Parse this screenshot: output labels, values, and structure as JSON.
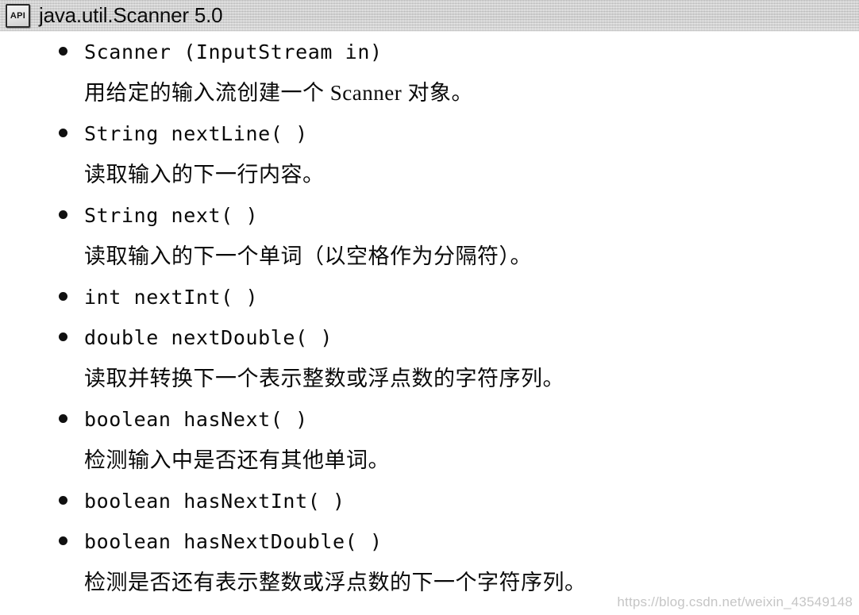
{
  "header": {
    "badge_label": "API",
    "badge_icon": "api-badge-icon",
    "title": "java.util.Scanner 5.0"
  },
  "entries": [
    {
      "signature": "Scanner (InputStream in)",
      "description": "用给定的输入流创建一个 Scanner 对象。"
    },
    {
      "signature": "String nextLine( )",
      "description": "读取输入的下一行内容。"
    },
    {
      "signature": "String next( )",
      "description": "读取输入的下一个单词（以空格作为分隔符）。"
    },
    {
      "signature": "int nextInt( )",
      "description": null
    },
    {
      "signature": "double nextDouble( )",
      "description": "读取并转换下一个表示整数或浮点数的字符序列。"
    },
    {
      "signature": "boolean hasNext( )",
      "description": "检测输入中是否还有其他单词。"
    },
    {
      "signature": "boolean hasNextInt( )",
      "description": null
    },
    {
      "signature": "boolean hasNextDouble( )",
      "description": "检测是否还有表示整数或浮点数的下一个字符序列。"
    }
  ],
  "watermark": {
    "text": "https://blog.csdn.net/weixin_43549148"
  }
}
